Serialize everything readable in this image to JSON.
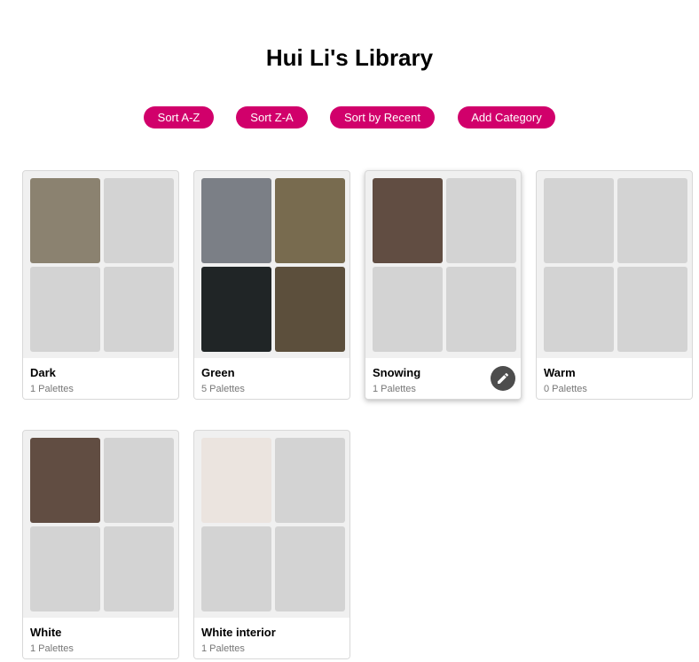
{
  "library": {
    "title": "Hui Li's Library"
  },
  "toolbar": {
    "buttons": [
      {
        "label": "Sort A-Z",
        "name": "sort-az-button"
      },
      {
        "label": "Sort Z-A",
        "name": "sort-za-button"
      },
      {
        "label": "Sort by Recent",
        "name": "sort-recent-button"
      },
      {
        "label": "Add Category",
        "name": "add-category-button"
      }
    ],
    "accent_color": "#d1006b"
  },
  "categories": [
    {
      "name": "Dark",
      "count": "1 Palettes",
      "swatches": [
        "#8b8270",
        "#d3d3d3",
        "#d3d3d3",
        "#d3d3d3"
      ],
      "hovered": false
    },
    {
      "name": "Green",
      "count": "5 Palettes",
      "swatches": [
        "#7b7f86",
        "#786b4f",
        "#202526",
        "#5c4f3c"
      ],
      "hovered": false
    },
    {
      "name": "Snowing",
      "count": "1 Palettes",
      "swatches": [
        "#614d42",
        "#d3d3d3",
        "#d3d3d3",
        "#d3d3d3"
      ],
      "hovered": true,
      "edit_icon": "pencil-icon"
    },
    {
      "name": "Warm",
      "count": "0 Palettes",
      "swatches": [
        "#d3d3d3",
        "#d3d3d3",
        "#d3d3d3",
        "#d3d3d3"
      ],
      "hovered": false
    },
    {
      "name": "White",
      "count": "1 Palettes",
      "swatches": [
        "#614d42",
        "#d3d3d3",
        "#d3d3d3",
        "#d3d3d3"
      ],
      "hovered": false
    },
    {
      "name": "White interior",
      "count": "1 Palettes",
      "swatches": [
        "#ebe4df",
        "#d3d3d3",
        "#d3d3d3",
        "#d3d3d3"
      ],
      "hovered": false
    }
  ],
  "colors": {
    "empty_swatch": "#d3d3d3",
    "card_background": "#f0f0f0",
    "edit_button": "#4d4d4d"
  }
}
